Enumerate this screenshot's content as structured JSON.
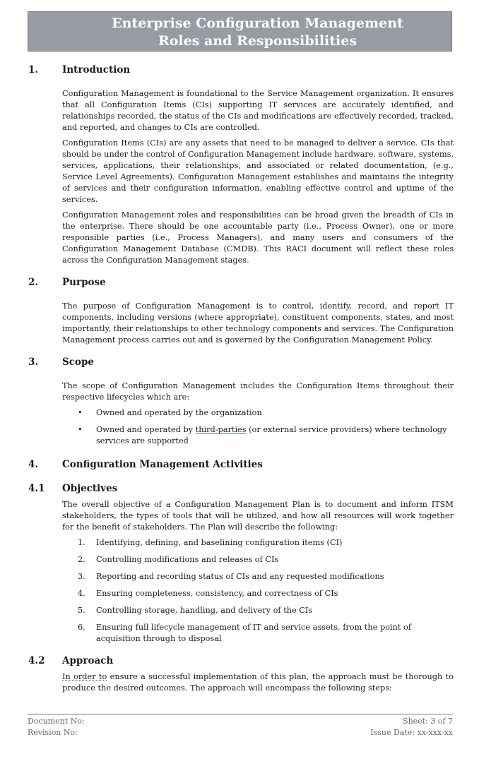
{
  "header": {
    "title_line1": "Enterprise Configuration Management",
    "title_line2": "Roles and Responsibilities",
    "banner_color": "#979ca4"
  },
  "sections": {
    "s1": {
      "num": "1.",
      "title": "Introduction",
      "p1": "Configuration Management is foundational to the Service Management organization. It ensures that all Configuration Items (CIs) supporting IT services are accurately identified, and relationships recorded, the status of the CIs and modifications are effectively recorded, tracked, and reported, and changes to CIs are controlled.",
      "p2": "Configuration Items (CIs) are any assets that need to be managed to deliver a service. CIs that should be under the control of Configuration Management include hardware, software, systems, services, applications, their relationships, and associated or related documentation, (e.g., Service Level Agreements). Configuration Management establishes and maintains the integrity of services and their configuration information, enabling effective control and uptime of the services.",
      "p3": "Configuration Management roles and responsibilities can be broad given the breadth of CIs in the enterprise. There should be one accountable party (i.e., Process Owner), one or more responsible parties (i.e., Process Managers), and many users and consumers of the Configuration Management Database (CMDB). This RACI document will reflect these roles across the Configuration Management stages."
    },
    "s2": {
      "num": "2.",
      "title": "Purpose",
      "p1": "The purpose of Configuration Management is to control, identify, record, and report IT components, including versions (where appropriate), constituent components, states, and most importantly, their relationships to other technology components and services. The Configuration Management process carries out and is governed by the Configuration Management Policy."
    },
    "s3": {
      "num": "3.",
      "title": "Scope",
      "p1": "The scope of Configuration Management includes the Configuration Items throughout their respective lifecycles which are:",
      "bullet_marker": "•",
      "b1": "Owned and operated by the organization",
      "b2_pre": "Owned and operated by ",
      "b2_link": "third-parties",
      "b2_post": " (or external service providers) where technology services are supported"
    },
    "s4": {
      "num": "4.",
      "title": "Configuration Management Activities"
    },
    "s41": {
      "num": "4.1",
      "title": "Objectives",
      "p1": "The overall objective of a Configuration Management Plan is to document and inform ITSM stakeholders, the types of tools that will be utilized, and how all resources will work together for the benefit of stakeholders. The Plan will describe the following:",
      "items": [
        {
          "n": "1.",
          "t": "Identifying, defining, and baselining configuration items (CI)"
        },
        {
          "n": "2.",
          "t": "Controlling modifications and releases of CIs"
        },
        {
          "n": "3.",
          "t": "Reporting and recording status of CIs and any requested modifications"
        },
        {
          "n": "4.",
          "t": "Ensuring completeness, consistency, and correctness of CIs"
        },
        {
          "n": "5.",
          "t": "Controlling storage, handling, and delivery of the CIs"
        },
        {
          "n": "6.",
          "t": "Ensuring full lifecycle management of IT and service assets, from the point of acquisition through to disposal"
        }
      ]
    },
    "s42": {
      "num": "4.2",
      "title": "Approach",
      "p1_flag": "In order to",
      "p1_rest": " ensure a successful implementation of this plan, the approach must be thorough to produce the desired outcomes. The approach will encompass the following steps:"
    }
  },
  "footer": {
    "doc_no": "Document No:",
    "rev_no": "Revision No:",
    "sheet": "Sheet: 3 of 7",
    "issue_date": "Issue Date: xx-xxx-xx"
  }
}
